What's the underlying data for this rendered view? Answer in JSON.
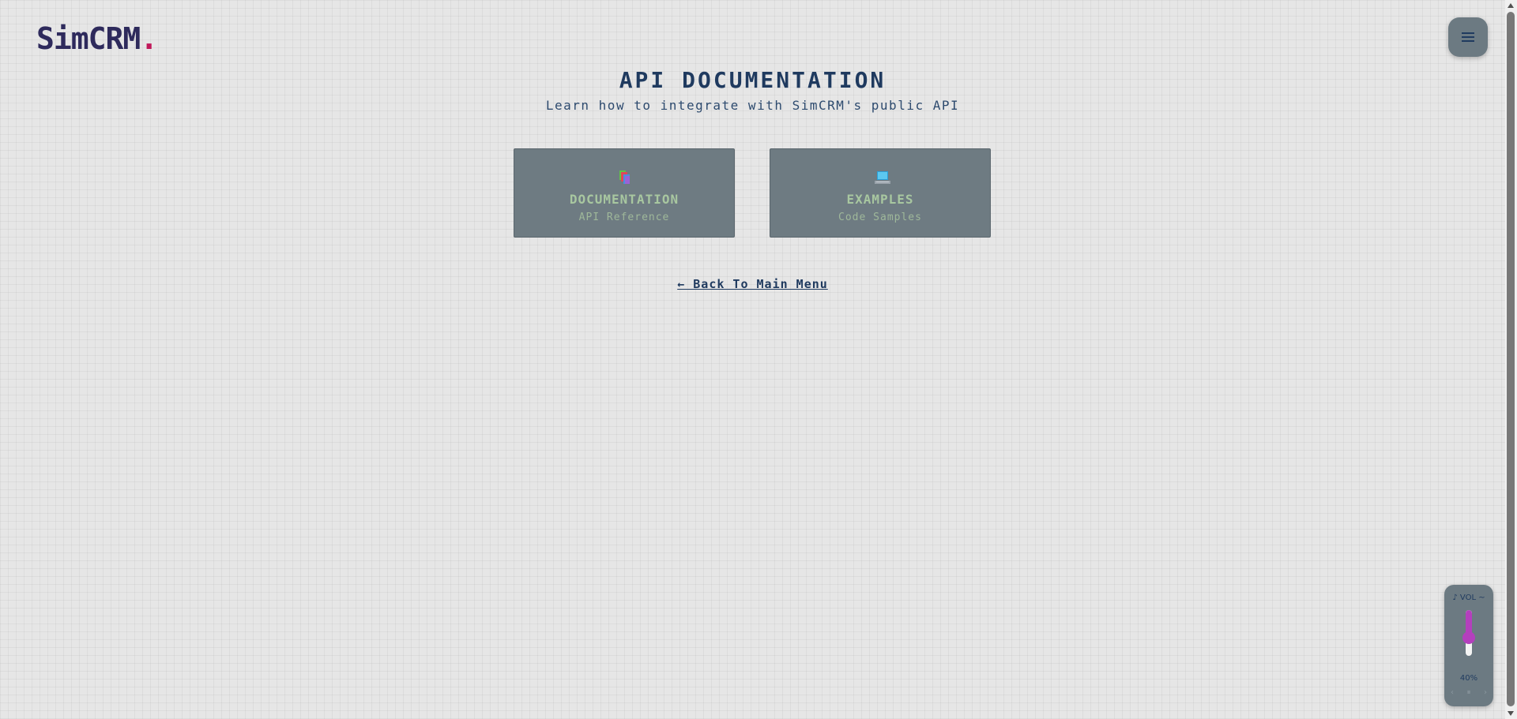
{
  "brand": {
    "name": "SimCRM",
    "dot": ".",
    "accent": "#c0195a"
  },
  "header": {
    "menu_icon": "hamburger-menu-icon"
  },
  "main": {
    "title": "API DOCUMENTATION",
    "subtitle": "Learn how to integrate with SimCRM's public API",
    "cards": [
      {
        "title": "DOCUMENTATION",
        "subtitle": "API Reference",
        "icon": "books-icon"
      },
      {
        "title": "EXAMPLES",
        "subtitle": "Code Samples",
        "icon": "laptop-icon"
      }
    ],
    "back_link": "← Back To Main Menu"
  },
  "volume": {
    "label": "♪ VOL ~",
    "value_percent": 40,
    "value_text": "40%",
    "prev": "‹",
    "pause": "⏸",
    "next": "›",
    "accent": "#b43fbd"
  },
  "colors": {
    "background": "#e6e6e6",
    "card": "#6e7b82",
    "card_text": "#a8c7a0",
    "heading": "#1f3a5f"
  }
}
